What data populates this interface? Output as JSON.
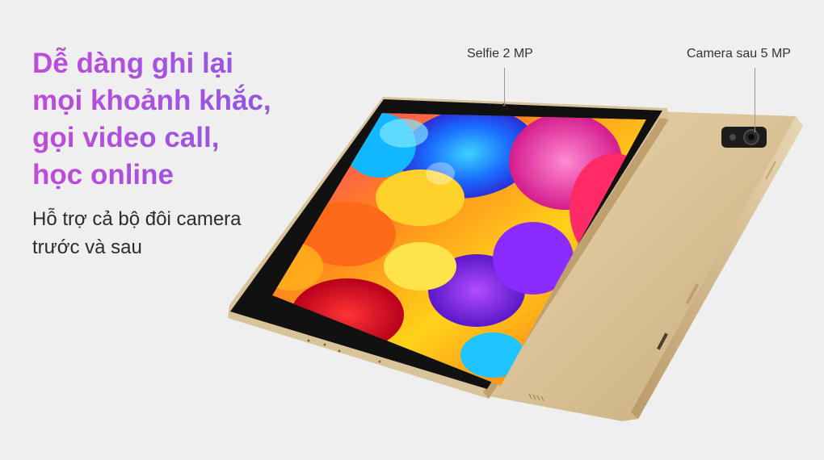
{
  "headline": {
    "lines": [
      "Dễ dàng ghi lại",
      "mọi khoảnh khắc,",
      "gọi video call,",
      "học online"
    ]
  },
  "subheadline": {
    "lines": [
      "Hỗ trợ cả bộ đôi camera",
      "trước và sau"
    ]
  },
  "callouts": {
    "front_camera": "Selfie 2 MP",
    "rear_camera": "Camera sau 5 MP"
  },
  "colors": {
    "background": "#efefef",
    "headline_gradient_start": "#c04bd8",
    "headline_gradient_end": "#8a56e6",
    "body_text": "#2c2c2c",
    "device_gold": "#d9c39a"
  }
}
